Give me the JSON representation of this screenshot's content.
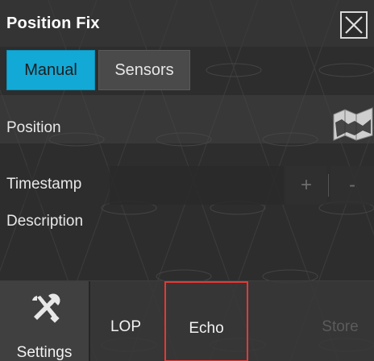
{
  "window": {
    "title": "Position Fix",
    "close_icon": "close-icon"
  },
  "tabs": [
    {
      "label": "Manual",
      "active": true
    },
    {
      "label": "Sensors",
      "active": false
    }
  ],
  "fields": {
    "position_label": "Position",
    "timestamp_label": "Timestamp",
    "plus_label": "+",
    "minus_label": "-",
    "description_label": "Description"
  },
  "toolbar": {
    "settings_label": "Settings",
    "settings_icon": "wrench-screwdriver-icon",
    "lop_label": "LOP",
    "echo_label": "Echo",
    "store_label": "Store"
  },
  "colors": {
    "accent": "#13a9d6",
    "highlight_border": "#e53935",
    "disabled_text": "#5b5b5b"
  }
}
